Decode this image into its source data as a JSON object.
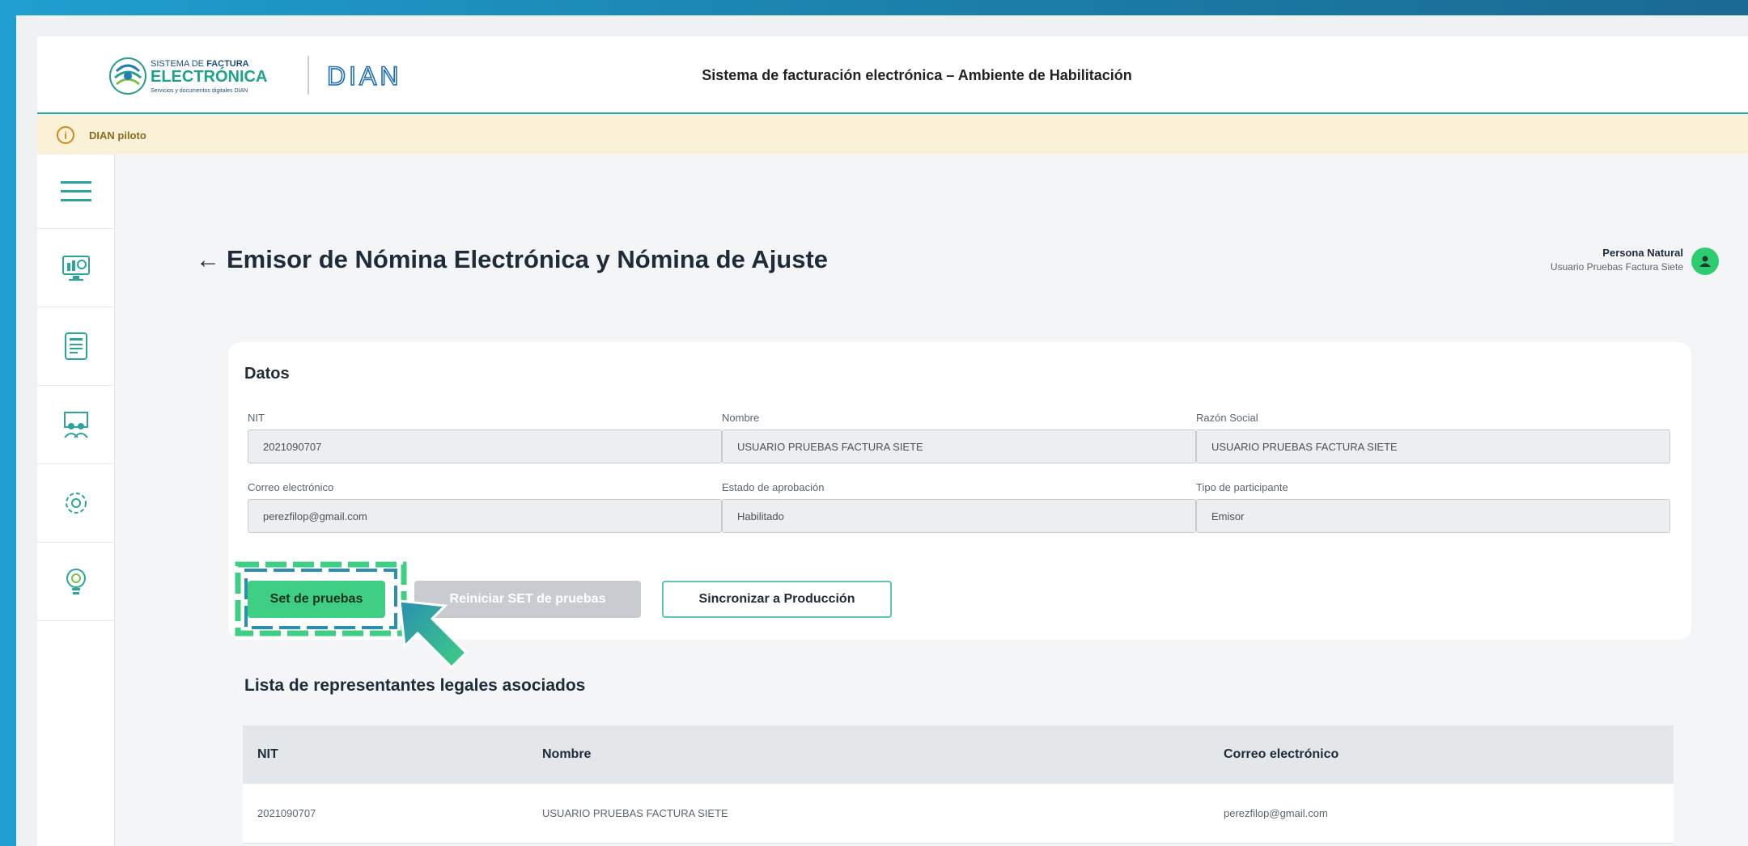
{
  "header": {
    "title": "Sistema de facturación electrónica – Ambiente de Habilitación",
    "logo_factura": {
      "line1_a": "SISTEMA DE ",
      "line1_b": "FACTURA",
      "line2": "ELECTRÓNICA",
      "line3": "Servicios y documentos digitales DIAN"
    },
    "logo_dian": "DIAN"
  },
  "notice": {
    "text": "DIAN piloto",
    "icon": "info-icon"
  },
  "sidebar": {
    "items": [
      {
        "icon": "menu-icon"
      },
      {
        "icon": "dashboard-icon"
      },
      {
        "icon": "document-icon"
      },
      {
        "icon": "people-icon"
      },
      {
        "icon": "settings-icon"
      },
      {
        "icon": "lightbulb-icon"
      }
    ]
  },
  "page": {
    "title": "Emisor de Nómina Electrónica y Nómina de Ajuste",
    "user_role": "Persona Natural",
    "user_name": "Usuario Pruebas Factura Siete"
  },
  "datos": {
    "title": "Datos",
    "fields": [
      {
        "label": "NIT",
        "value": "2021090707"
      },
      {
        "label": "Nombre",
        "value": "USUARIO PRUEBAS FACTURA SIETE"
      },
      {
        "label": "Razón Social",
        "value": "USUARIO PRUEBAS FACTURA SIETE"
      },
      {
        "label": "Correo electrónico",
        "value": "perezfilop@gmail.com"
      },
      {
        "label": "Estado de aprobación",
        "value": "Habilitado"
      },
      {
        "label": "Tipo de participante",
        "value": "Emisor"
      }
    ],
    "buttons": {
      "set": "Set de pruebas",
      "reiniciar": "Reiniciar SET de pruebas",
      "sync": "Sincronizar a Producción"
    }
  },
  "representantes": {
    "title": "Lista de representantes legales asociados",
    "columns": [
      "NIT",
      "Nombre",
      "Correo electrónico"
    ],
    "rows": [
      [
        "2021090707",
        "USUARIO PRUEBAS FACTURA SIETE",
        "perezfilop@gmail.com"
      ]
    ]
  },
  "colors": {
    "accent": "#3ecf85",
    "teal": "#2fa89a",
    "notice_bg": "#fbf1d7"
  }
}
